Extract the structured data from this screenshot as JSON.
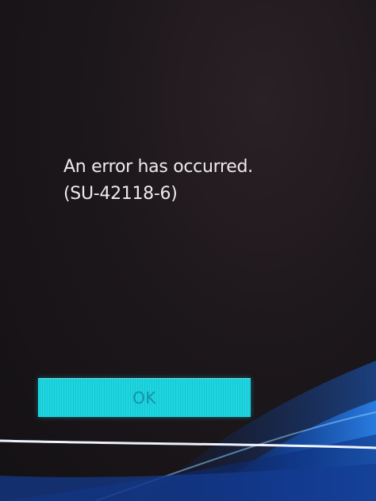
{
  "dialog": {
    "message_line1": "An error has occurred.",
    "message_line2": "(SU-42118-6)",
    "ok_label": "OK"
  },
  "colors": {
    "background": "#1c171b",
    "text": "#ecebee",
    "button": "#1fd6e0",
    "wave_blue": "#1d6fd6"
  }
}
